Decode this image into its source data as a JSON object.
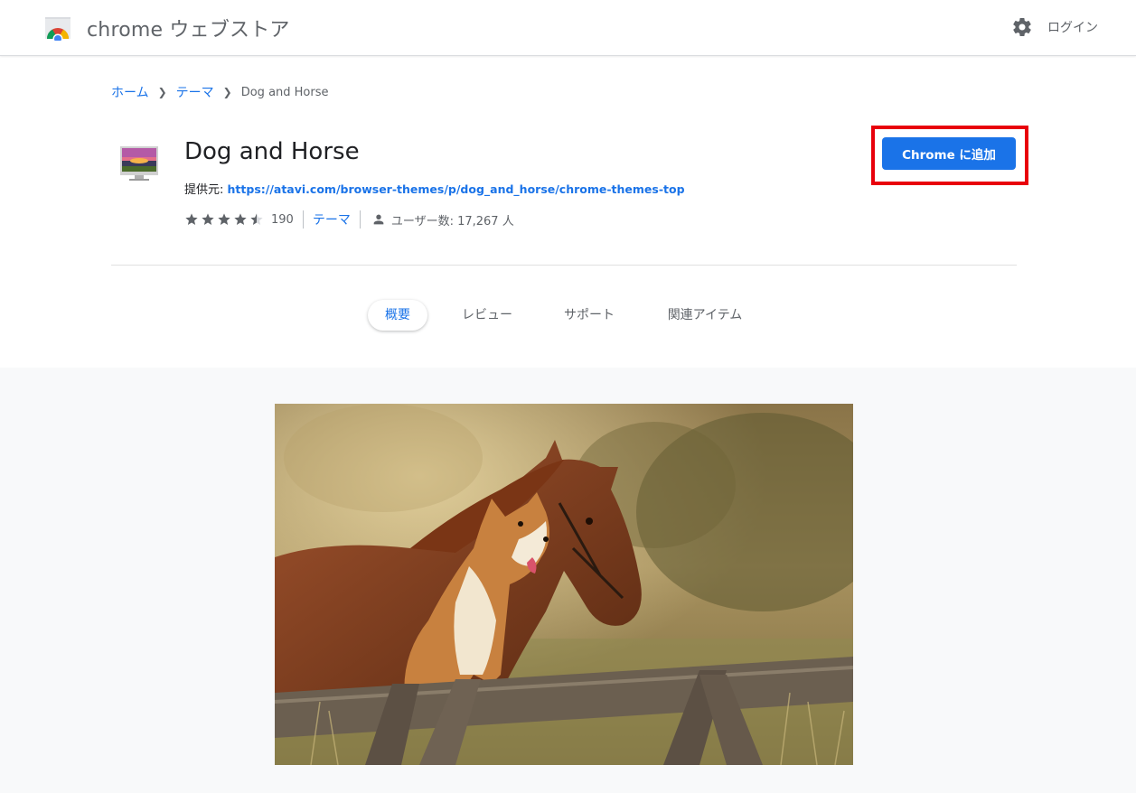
{
  "header": {
    "store_title": "chrome ウェブストア",
    "login_label": "ログイン"
  },
  "breadcrumb": {
    "home": "ホーム",
    "category": "テーマ",
    "current": "Dog and Horse"
  },
  "item": {
    "title": "Dog and Horse",
    "provider_label": "提供元:",
    "provider_url": "https://atavi.com/browser-themes/p/dog_and_horse/chrome-themes-top",
    "rating_stars": 4.5,
    "rating_count": "190",
    "category": "テーマ",
    "users_text": "ユーザー数: 17,267 人"
  },
  "actions": {
    "add_label": "Chrome に追加"
  },
  "tabs": [
    {
      "label": "概要",
      "active": true
    },
    {
      "label": "レビュー",
      "active": false
    },
    {
      "label": "サポート",
      "active": false
    },
    {
      "label": "関連アイテム",
      "active": false
    }
  ],
  "colors": {
    "accent": "#1a73e8",
    "highlight": "#e8000b"
  }
}
